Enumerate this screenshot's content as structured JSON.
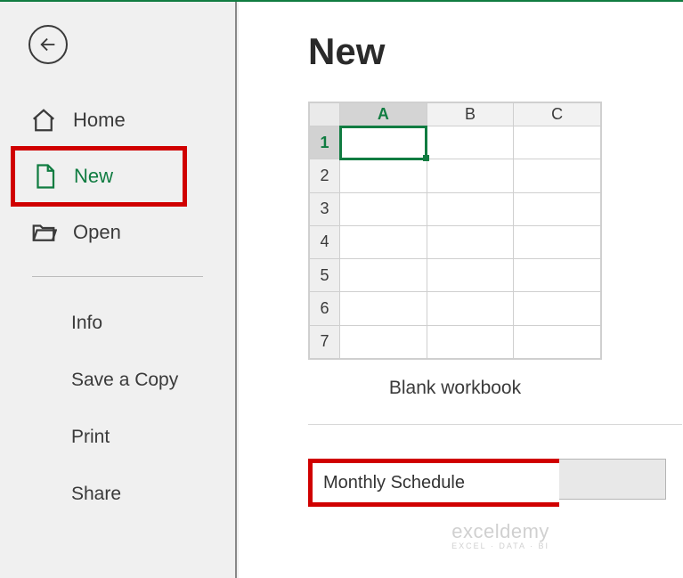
{
  "sidebar": {
    "items": [
      {
        "label": "Home"
      },
      {
        "label": "New"
      },
      {
        "label": "Open"
      }
    ],
    "sub_items": [
      {
        "label": "Info"
      },
      {
        "label": "Save a Copy"
      },
      {
        "label": "Print"
      },
      {
        "label": "Share"
      }
    ]
  },
  "main": {
    "title": "New",
    "blank_tile_label": "Blank workbook",
    "thumb": {
      "columns": [
        "A",
        "B",
        "C"
      ],
      "rows": [
        "1",
        "2",
        "3",
        "4",
        "5",
        "6",
        "7"
      ]
    },
    "search": {
      "value": "Monthly Schedule"
    }
  },
  "watermark": {
    "top": "exceldemy",
    "bot": "EXCEL · DATA · BI"
  }
}
